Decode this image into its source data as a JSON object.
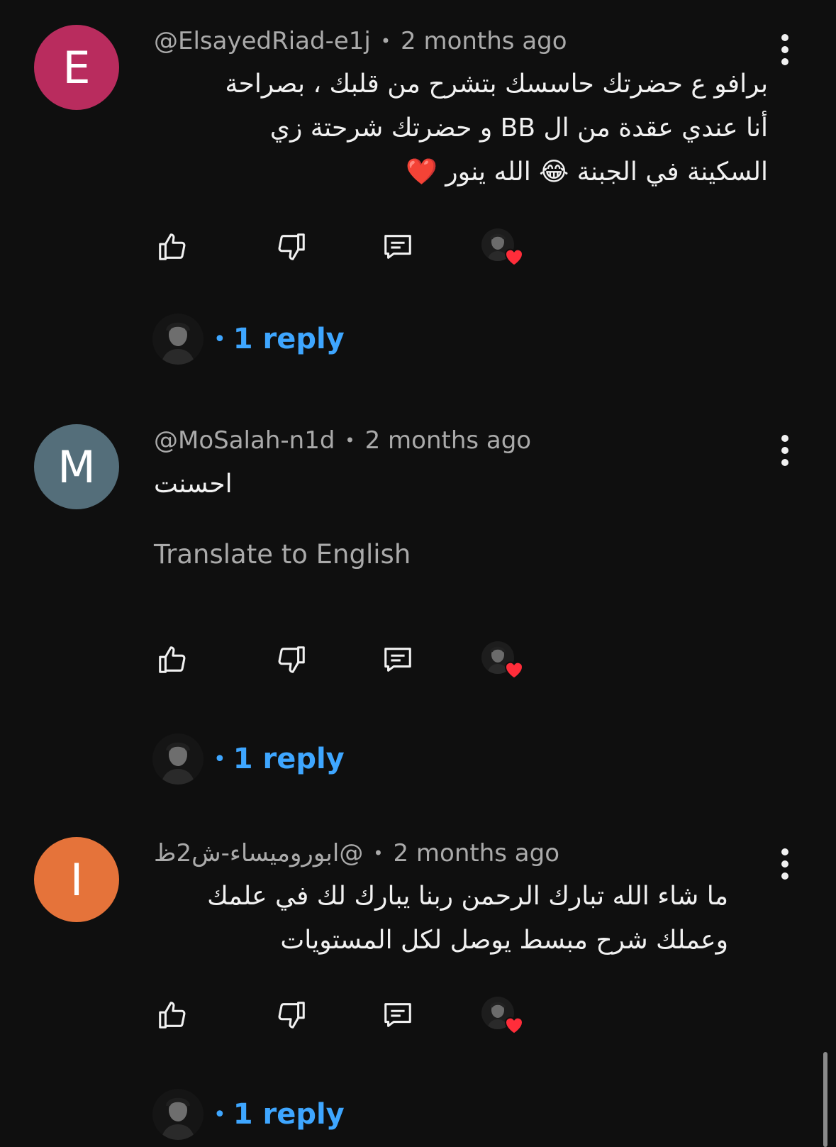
{
  "comments": [
    {
      "avatar_letter": "E",
      "avatar_color": "#b92c5e",
      "handle": "@ElsayedRiad-e1j",
      "time": "2 months ago",
      "text_line1": "برافو ع حضرتك حاسسك بتشرح من قلبك ، بصراحة",
      "text_line2": "أنا عندي عقدة من ال BB و حضرتك شرحتة زي",
      "text_line3": "السكينة في الجبنة 😂 الله ينور ❤️",
      "reply_count": "1 reply"
    },
    {
      "avatar_letter": "M",
      "avatar_color": "#546e7a",
      "handle": "@MoSalah-n1d",
      "time": "2 months ago",
      "text_line1": "احسنت",
      "translate_label": "Translate to English",
      "reply_count": "1 reply"
    },
    {
      "avatar_letter": "I",
      "avatar_color": "#e5733a",
      "handle": "@ابوروميساء-ش2ظ",
      "time": "2 months ago",
      "text_line1": "ما شاء الله تبارك الرحمن ربنا يبارك لك في علمك",
      "text_line2": "وعملك شرح مبسط يوصل لكل المستويات",
      "reply_count": "1 reply"
    }
  ],
  "separator": "•",
  "icons": {
    "like": "thumbs-up-icon",
    "dislike": "thumbs-down-icon",
    "reply": "comment-icon",
    "more": "more-vertical-icon",
    "creator_heart": "creator-heart-icon"
  },
  "colors": {
    "background": "#0f0f0f",
    "accent_link": "#3ea6ff",
    "heart": "#ff2d3a"
  }
}
